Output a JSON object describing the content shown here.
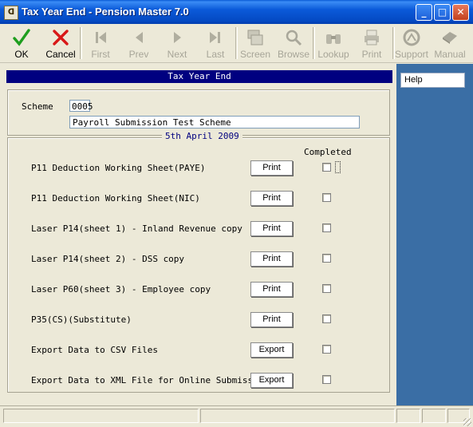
{
  "window": {
    "title": "Tax Year End - Pension Master 7.0",
    "icon_text": "ᗡ",
    "controls": {
      "minimize": "_",
      "maximize": "□",
      "close": "✕"
    }
  },
  "toolbar": {
    "ok": "OK",
    "cancel": "Cancel",
    "first": "First",
    "prev": "Prev",
    "next": "Next",
    "last": "Last",
    "screen": "Screen",
    "browse": "Browse",
    "lookup": "Lookup",
    "print": "Print",
    "support": "Support",
    "manual": "Manual"
  },
  "panel": {
    "heading": "Tax Year End",
    "scheme_label": "Scheme",
    "scheme_code": "0005",
    "scheme_name": "Payroll Submission Test Scheme",
    "date": "5th April 2009",
    "completed_header": "Completed"
  },
  "rows": [
    {
      "label": "P11 Deduction Working Sheet(PAYE)",
      "action": "Print",
      "completed": false
    },
    {
      "label": "P11 Deduction Working Sheet(NIC)",
      "action": "Print",
      "completed": false
    },
    {
      "label": "Laser P14(sheet 1) - Inland Revenue copy",
      "action": "Print",
      "completed": false
    },
    {
      "label": "Laser P14(sheet 2) - DSS copy",
      "action": "Print",
      "completed": false
    },
    {
      "label": "Laser P60(sheet 3) - Employee copy",
      "action": "Print",
      "completed": false
    },
    {
      "label": "P35(CS)(Substitute)",
      "action": "Print",
      "completed": false
    },
    {
      "label": "Export Data to CSV Files",
      "action": "Export",
      "completed": false
    },
    {
      "label": "Export Data to XML File for Online Submission",
      "action": "Export",
      "completed": false
    }
  ],
  "side": {
    "help": "Help"
  },
  "colors": {
    "titlebar": "#0b5ad9",
    "panel_header": "#000080",
    "side_panel": "#3a6ea5",
    "ok_green": "#1e9e1e",
    "cancel_red": "#d81818"
  }
}
